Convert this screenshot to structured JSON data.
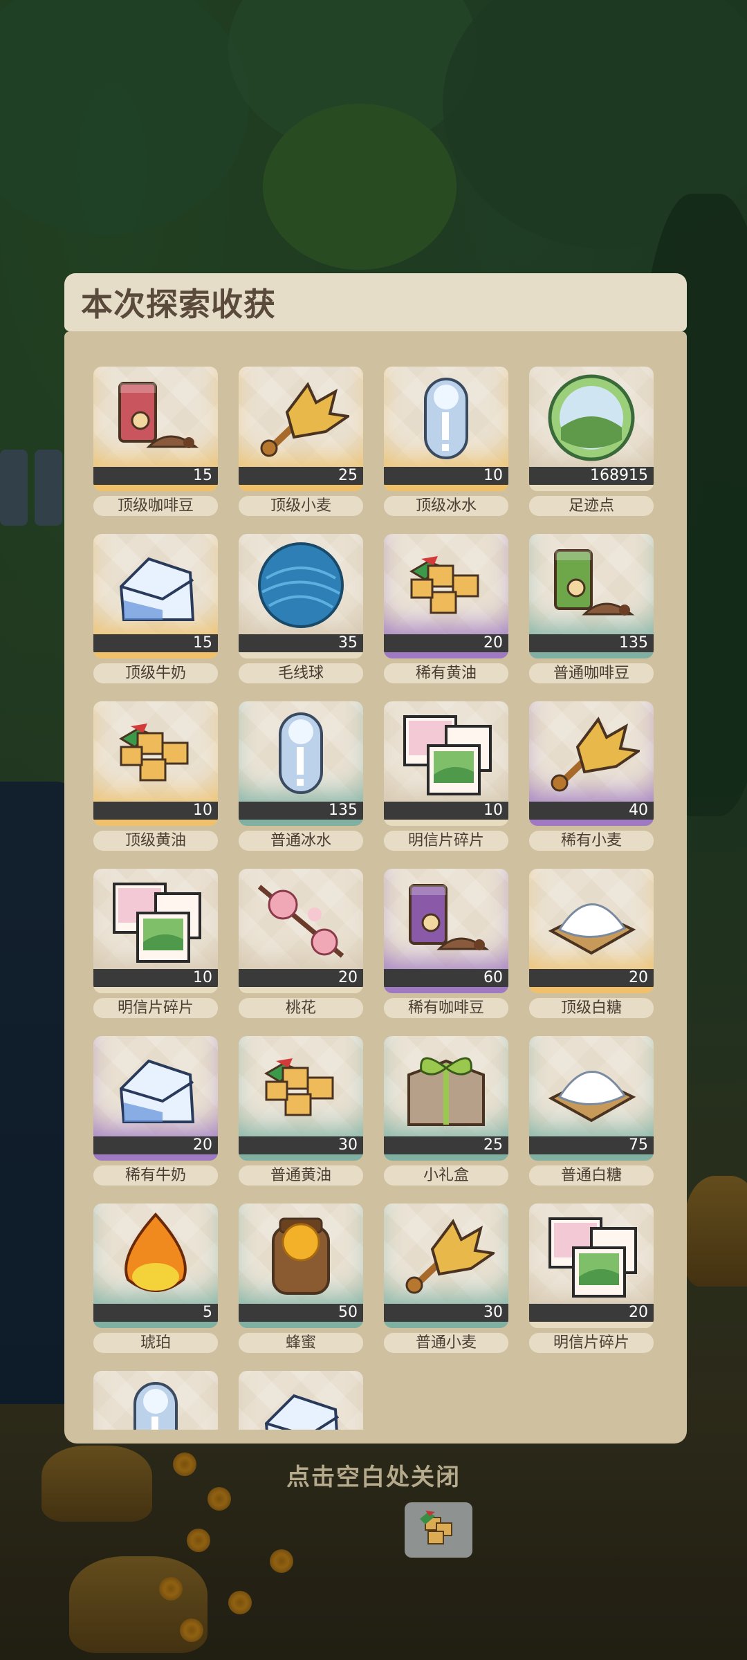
{
  "title": "本次探索收获",
  "close_hint": "点击空白处关闭",
  "colors": {
    "gold": "#efc26b",
    "purple": "#a07cc4",
    "teal": "#7fb4a7",
    "plain": "#d4c6ad"
  },
  "items": [
    {
      "name": "顶级咖啡豆",
      "count": "15",
      "rarity": "gold",
      "icon": "coffee-bag-icon",
      "tint": "#c9555e"
    },
    {
      "name": "顶级小麦",
      "count": "25",
      "rarity": "gold",
      "icon": "wheat-icon",
      "tint": "#e8b84a"
    },
    {
      "name": "顶级冰水",
      "count": "10",
      "rarity": "gold",
      "icon": "ice-water-icon",
      "tint": "#bcd2ea"
    },
    {
      "name": "足迹点",
      "count": "168915",
      "rarity": "plain",
      "icon": "footprint-orb-icon",
      "tint": "#6aa65a"
    },
    {
      "name": "顶级牛奶",
      "count": "15",
      "rarity": "gold",
      "icon": "milk-carton-icon",
      "tint": "#5f8fd8"
    },
    {
      "name": "毛线球",
      "count": "35",
      "rarity": "plain",
      "icon": "yarn-ball-icon",
      "tint": "#2d7fb5"
    },
    {
      "name": "稀有黄油",
      "count": "20",
      "rarity": "purple",
      "icon": "butter-icon",
      "tint": "#efbb5a"
    },
    {
      "name": "普通咖啡豆",
      "count": "135",
      "rarity": "teal",
      "icon": "coffee-bag-icon",
      "tint": "#6ea64a"
    },
    {
      "name": "顶级黄油",
      "count": "10",
      "rarity": "gold",
      "icon": "butter-icon",
      "tint": "#efbb5a"
    },
    {
      "name": "普通冰水",
      "count": "135",
      "rarity": "teal",
      "icon": "ice-water-icon",
      "tint": "#bcd2ea"
    },
    {
      "name": "明信片碎片",
      "count": "10",
      "rarity": "plain",
      "icon": "postcard-icon",
      "tint": "#7fbf6a"
    },
    {
      "name": "稀有小麦",
      "count": "40",
      "rarity": "purple",
      "icon": "wheat-icon",
      "tint": "#e8b84a"
    },
    {
      "name": "明信片碎片",
      "count": "10",
      "rarity": "plain",
      "icon": "postcard-icon",
      "tint": "#7fbf6a"
    },
    {
      "name": "桃花",
      "count": "20",
      "rarity": "plain",
      "icon": "peach-blossom-icon",
      "tint": "#f0a7b6"
    },
    {
      "name": "稀有咖啡豆",
      "count": "60",
      "rarity": "purple",
      "icon": "coffee-bag-icon",
      "tint": "#8a5aa8"
    },
    {
      "name": "顶级白糖",
      "count": "20",
      "rarity": "gold",
      "icon": "sugar-icon",
      "tint": "#ffffff"
    },
    {
      "name": "稀有牛奶",
      "count": "20",
      "rarity": "purple",
      "icon": "milk-carton-icon",
      "tint": "#5f8fd8"
    },
    {
      "name": "普通黄油",
      "count": "30",
      "rarity": "teal",
      "icon": "butter-icon",
      "tint": "#efbb5a"
    },
    {
      "name": "小礼盒",
      "count": "25",
      "rarity": "teal",
      "icon": "gift-box-icon",
      "tint": "#9ac84e"
    },
    {
      "name": "普通白糖",
      "count": "75",
      "rarity": "teal",
      "icon": "sugar-icon",
      "tint": "#ffffff"
    },
    {
      "name": "琥珀",
      "count": "5",
      "rarity": "teal",
      "icon": "amber-icon",
      "tint": "#f08a1e"
    },
    {
      "name": "蜂蜜",
      "count": "50",
      "rarity": "teal",
      "icon": "honey-jar-icon",
      "tint": "#f3b12a"
    },
    {
      "name": "普通小麦",
      "count": "30",
      "rarity": "teal",
      "icon": "wheat-icon",
      "tint": "#e8b84a"
    },
    {
      "name": "明信片碎片",
      "count": "20",
      "rarity": "plain",
      "icon": "postcard-icon",
      "tint": "#7fbf6a"
    },
    {
      "name": "",
      "count": "",
      "rarity": "plain",
      "icon": "ice-water-icon",
      "tint": "#bcd2ea"
    },
    {
      "name": "",
      "count": "",
      "rarity": "plain",
      "icon": "milk-carton-icon",
      "tint": "#5f8fd8"
    }
  ]
}
